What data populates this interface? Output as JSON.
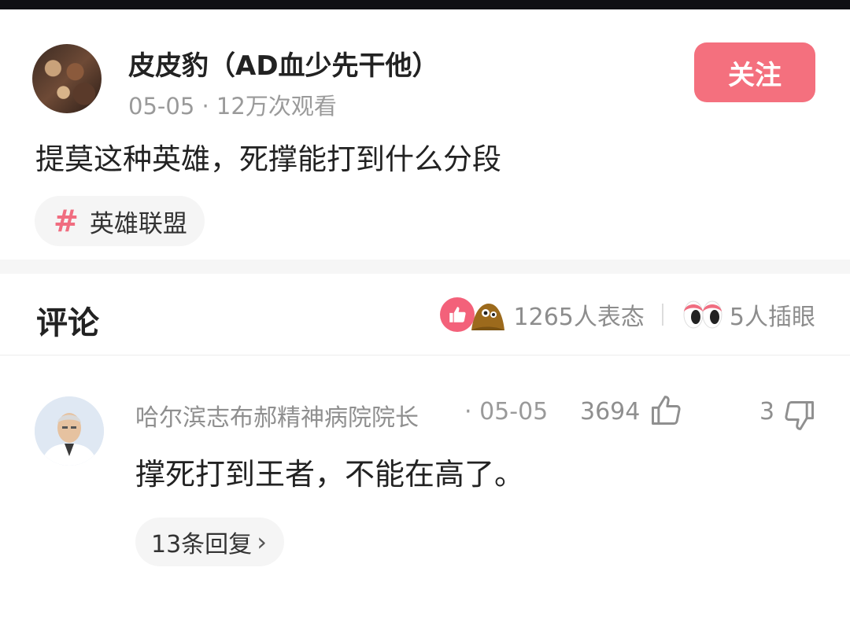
{
  "post": {
    "author": "皮皮豹（AD血少先干他）",
    "meta": "05-05 · 12万次观看",
    "follow_label": "关注",
    "title": "提莫这种英雄，死撑能打到什么分段",
    "topic": "英雄联盟",
    "topic_icon": "hash-icon"
  },
  "comments_header": {
    "title": "评论",
    "reaction_count": "1265人表态",
    "eyes_count": "5人插眼"
  },
  "comment": {
    "author": "哈尔滨志布郝精神病院院长",
    "date": "· 05-05",
    "likes": "3694",
    "dislikes": "3",
    "text": "撑死打到王者，不能在高了。",
    "replies_label": "13条回复",
    "replies_chevron": "›"
  },
  "colors": {
    "accent": "#f4707e",
    "like": "#f3617a",
    "muted_text": "#8f8f8f"
  }
}
